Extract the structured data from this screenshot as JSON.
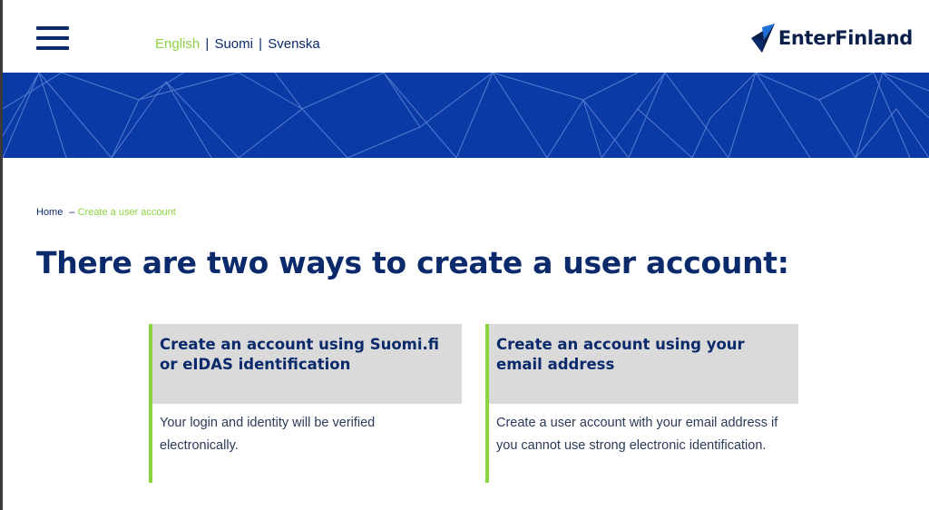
{
  "header": {
    "menu_icon": "hamburger-menu-icon",
    "languages": [
      {
        "label": "English",
        "active": true
      },
      {
        "label": "Suomi",
        "active": false
      },
      {
        "label": "Svenska",
        "active": false
      }
    ],
    "separator": "|",
    "logo": {
      "text": "EnterFinland",
      "icon": "enterfinland-logo-mark"
    }
  },
  "colors": {
    "brand_blue": "#0a3aa6",
    "text_navy": "#0a2a6b",
    "accent_green": "#8bd33f",
    "card_head_bg": "#dadada"
  },
  "breadcrumb": {
    "home": "Home",
    "separator": "–",
    "current": "Create a user account"
  },
  "main": {
    "title": "There are two ways to create a user account:",
    "cards": [
      {
        "title_line1": "Create an account using Suomi.fi",
        "title_line2": "or eIDAS identification",
        "desc_line1": "Your login and identity will be verified",
        "desc_line2": "electronically."
      },
      {
        "title_line1": "Create an account using your",
        "title_line2": "email address",
        "desc_line1": "Create a user account with your email address if",
        "desc_line2": "you cannot use strong electronic identification."
      }
    ]
  }
}
